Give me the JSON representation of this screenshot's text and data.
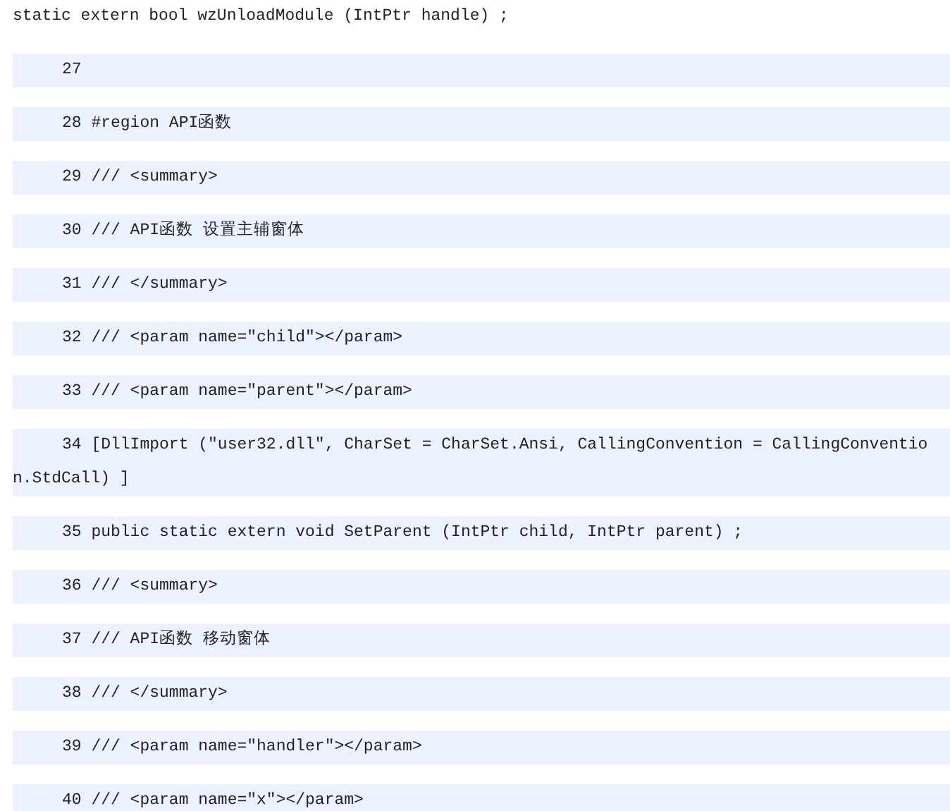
{
  "intro_line": "static extern bool wzUnloadModule (IntPtr handle) ;",
  "code_lines": [
    "27",
    "28 #region API函数",
    "29 /// <summary>",
    "30 /// API函数 设置主辅窗体",
    "31 /// </summary>",
    "32 /// <param name=″child″></param>",
    "33 /// <param name=″parent″></param>",
    "34 [DllImport (″user32.dll″, CharSet = CharSet.Ansi, CallingConvention = CallingConvention.StdCall) ]",
    "35 public static extern void SetParent (IntPtr child, IntPtr parent) ;",
    "36 /// <summary>",
    "37 /// API函数 移动窗体",
    "38 /// </summary>",
    "39 /// <param name=″handler″></param>",
    "40 /// <param name=″x″></param>"
  ]
}
